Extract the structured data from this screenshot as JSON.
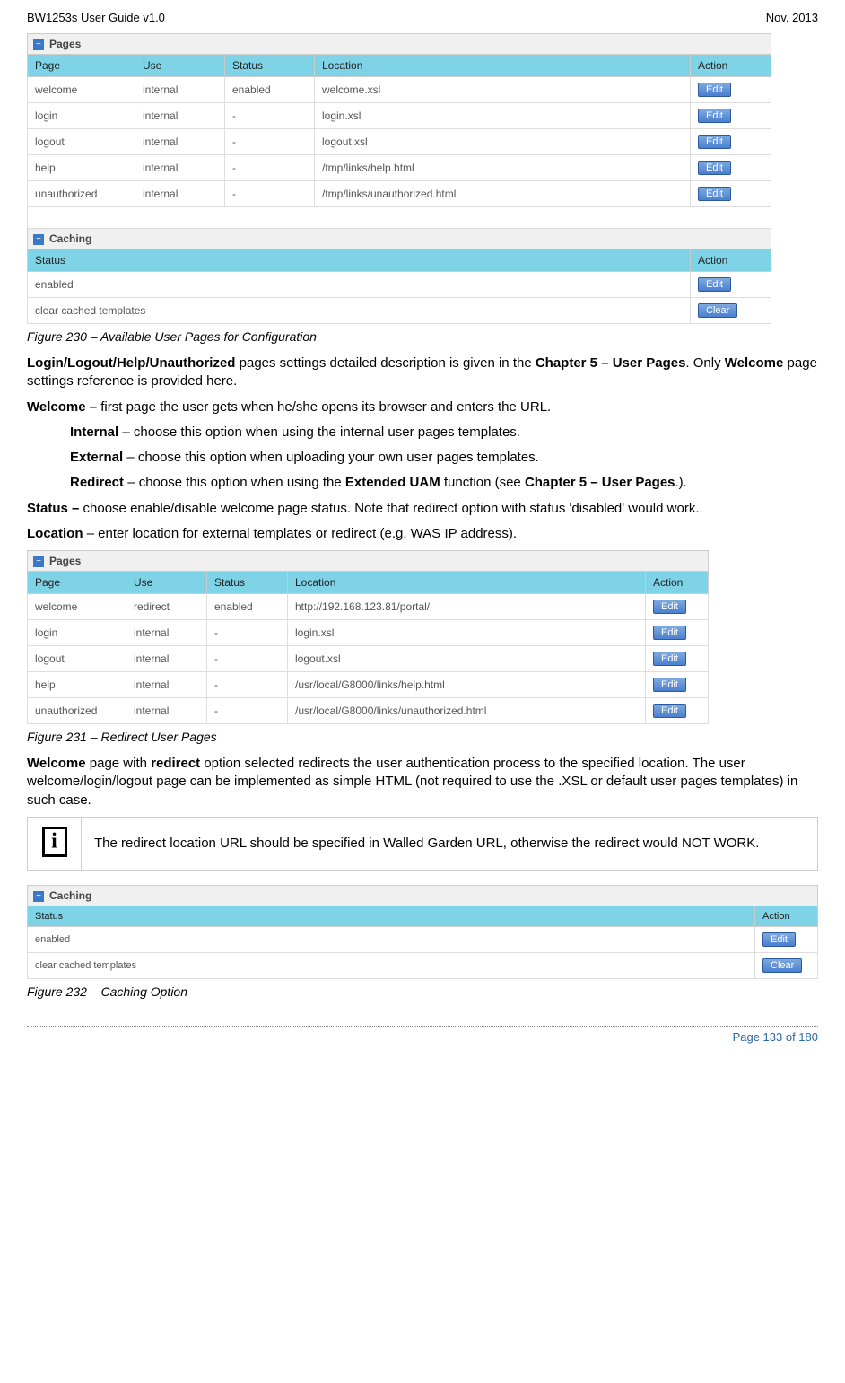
{
  "doc": {
    "title_left": "BW1253s User Guide v1.0",
    "title_right": "Nov.  2013",
    "page_footer": "Page 133 of 180"
  },
  "pages_section": {
    "title": "Pages",
    "headers": {
      "page": "Page",
      "use": "Use",
      "status": "Status",
      "location": "Location",
      "action": "Action"
    },
    "rows": [
      {
        "page": "welcome",
        "use": "internal",
        "status": "enabled",
        "location": "welcome.xsl",
        "action": "Edit"
      },
      {
        "page": "login",
        "use": "internal",
        "status": "-",
        "location": "login.xsl",
        "action": "Edit"
      },
      {
        "page": "logout",
        "use": "internal",
        "status": "-",
        "location": "logout.xsl",
        "action": "Edit"
      },
      {
        "page": "help",
        "use": "internal",
        "status": "-",
        "location": "/tmp/links/help.html",
        "action": "Edit"
      },
      {
        "page": "unauthorized",
        "use": "internal",
        "status": "-",
        "location": "/tmp/links/unauthorized.html",
        "action": "Edit"
      }
    ]
  },
  "caching_section": {
    "title": "Caching",
    "headers": {
      "status": "Status",
      "action": "Action"
    },
    "rows": [
      {
        "status": "enabled",
        "action": "Edit"
      },
      {
        "status": "clear cached templates",
        "action": "Clear"
      }
    ]
  },
  "fig230": "Figure 230 – Available User Pages for Configuration",
  "text1_a": "Login/Logout/Help/Unauthorized",
  "text1_b": " pages settings detailed description is given in the ",
  "text1_c": "Chapter 5 – User Pages",
  "text1_d": ". Only ",
  "text1_e": "Welcome",
  "text1_f": " page settings reference is provided here.",
  "text2_a": "Welcome –",
  "text2_b": " first page the user gets when he/she opens its browser and enters the URL.",
  "opt_internal_a": "Internal",
  "opt_internal_b": " – choose this option when using the internal user pages templates.",
  "opt_external_a": "External",
  "opt_external_b": " – choose this option when uploading your own user pages templates.",
  "opt_redirect_a": "Redirect",
  "opt_redirect_b": " – choose this option when using the ",
  "opt_redirect_c": "Extended UAM",
  "opt_redirect_d": " function (see ",
  "opt_redirect_e": "Chapter 5 – User Pages",
  "opt_redirect_f": ".).",
  "status_a": "Status –",
  "status_b": " choose enable/disable welcome page status. Note that redirect option with status 'disabled' would work.",
  "location_a": "Location",
  "location_b": " – enter location for external templates or redirect (e.g. WAS IP address).",
  "pages_section2": {
    "title": "Pages",
    "headers": {
      "page": "Page",
      "use": "Use",
      "status": "Status",
      "location": "Location",
      "action": "Action"
    },
    "rows": [
      {
        "page": "welcome",
        "use": "redirect",
        "status": "enabled",
        "location": "http://192.168.123.81/portal/",
        "action": "Edit"
      },
      {
        "page": "login",
        "use": "internal",
        "status": "-",
        "location": "login.xsl",
        "action": "Edit"
      },
      {
        "page": "logout",
        "use": "internal",
        "status": "-",
        "location": "logout.xsl",
        "action": "Edit"
      },
      {
        "page": "help",
        "use": "internal",
        "status": "-",
        "location": "/usr/local/G8000/links/help.html",
        "action": "Edit"
      },
      {
        "page": "unauthorized",
        "use": "internal",
        "status": "-",
        "location": "/usr/local/G8000/links/unauthorized.html",
        "action": "Edit"
      }
    ]
  },
  "fig231": "Figure 231 – Redirect User Pages",
  "redirect_para_a": "Welcome",
  "redirect_para_b": " page with ",
  "redirect_para_c": "redirect",
  "redirect_para_d": " option selected redirects the user authentication process to the specified location. The user welcome/login/logout page can be implemented as simple HTML (not required to use the .XSL or default user pages templates) in such case.",
  "info_note": "The redirect location URL should be specified in Walled Garden URL, otherwise the redirect would NOT WORK.",
  "caching_section2": {
    "title": "Caching",
    "headers": {
      "status": "Status",
      "action": "Action"
    },
    "rows": [
      {
        "status": "enabled",
        "action": "Edit"
      },
      {
        "status": "clear cached templates",
        "action": "Clear"
      }
    ]
  },
  "fig232": "Figure 232 – Caching Option"
}
